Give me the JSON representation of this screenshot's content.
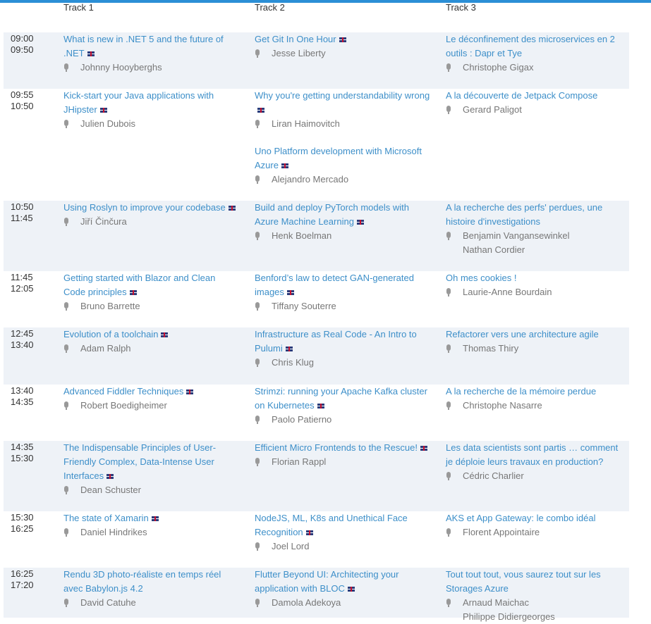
{
  "tracks": [
    "Track 1",
    "Track 2",
    "Track 3"
  ],
  "slots": [
    {
      "start": "09:00",
      "end": "09:50",
      "cells": [
        [
          {
            "title": "What is new in .NET 5 and the future of .NET",
            "english": true,
            "speakers": [
              "Johnny Hooyberghs"
            ]
          }
        ],
        [
          {
            "title": "Get Git In One Hour",
            "english": true,
            "speakers": [
              "Jesse Liberty"
            ]
          }
        ],
        [
          {
            "title": "Le déconfinement des microservices en 2 outils : Dapr et Tye",
            "english": false,
            "speakers": [
              "Christophe Gigax"
            ]
          }
        ]
      ]
    },
    {
      "start": "09:55",
      "end": "10:50",
      "cells": [
        [
          {
            "title": "Kick-start your Java applications with JHipster",
            "english": true,
            "speakers": [
              "Julien Dubois"
            ]
          }
        ],
        [
          {
            "title": "Why you're getting understandability wrong",
            "english": true,
            "speakers": [
              "Liran Haimovitch"
            ]
          },
          {
            "title": "Uno Platform development with Microsoft Azure",
            "english": true,
            "speakers": [
              "Alejandro Mercado"
            ]
          }
        ],
        [
          {
            "title": "A la découverte de Jetpack Compose",
            "english": false,
            "speakers": [
              "Gerard Paligot"
            ]
          }
        ]
      ]
    },
    {
      "start": "10:50",
      "end": "11:45",
      "cells": [
        [
          {
            "title": "Using Roslyn to improve your codebase",
            "english": true,
            "speakers": [
              "Jiří Činčura"
            ]
          }
        ],
        [
          {
            "title": "Build and deploy PyTorch models with Azure Machine Learning",
            "english": true,
            "speakers": [
              "Henk Boelman"
            ]
          }
        ],
        [
          {
            "title": "A la recherche des perfs' perdues, une histoire d'investigations",
            "english": false,
            "speakers": [
              "Benjamin Vangansewinkel",
              "Nathan Cordier"
            ]
          }
        ]
      ]
    },
    {
      "start": "11:45",
      "end": "12:05",
      "cells": [
        [
          {
            "title": "Getting started with Blazor and Clean Code principles",
            "english": true,
            "speakers": [
              "Bruno Barrette"
            ]
          }
        ],
        [
          {
            "title": "Benford’s law to detect GAN-generated images",
            "english": true,
            "speakers": [
              "Tiffany Souterre"
            ]
          }
        ],
        [
          {
            "title": "Oh mes cookies !",
            "english": false,
            "speakers": [
              "Laurie-Anne Bourdain"
            ]
          }
        ]
      ]
    },
    {
      "start": "12:45",
      "end": "13:40",
      "cells": [
        [
          {
            "title": "Evolution of a toolchain",
            "english": true,
            "speakers": [
              "Adam Ralph"
            ]
          }
        ],
        [
          {
            "title": "Infrastructure as Real Code - An Intro to Pulumi",
            "english": true,
            "speakers": [
              "Chris Klug"
            ]
          }
        ],
        [
          {
            "title": "Refactorer vers une architecture agile",
            "english": false,
            "speakers": [
              "Thomas Thiry"
            ]
          }
        ]
      ]
    },
    {
      "start": "13:40",
      "end": "14:35",
      "cells": [
        [
          {
            "title": "Advanced Fiddler Techniques",
            "english": true,
            "speakers": [
              "Robert Boedigheimer"
            ]
          }
        ],
        [
          {
            "title": "Strimzi: running your Apache Kafka cluster on Kubernetes",
            "english": true,
            "speakers": [
              "Paolo Patierno"
            ]
          }
        ],
        [
          {
            "title": "A la recherche de la mémoire perdue",
            "english": false,
            "speakers": [
              "Christophe Nasarre"
            ]
          }
        ]
      ]
    },
    {
      "start": "14:35",
      "end": "15:30",
      "cells": [
        [
          {
            "title": "The Indispensable Principles of User-Friendly Complex, Data-Intense User Interfaces",
            "english": true,
            "speakers": [
              "Dean Schuster"
            ]
          }
        ],
        [
          {
            "title": "Efficient Micro Frontends to the Rescue!",
            "english": true,
            "speakers": [
              "Florian Rappl"
            ]
          }
        ],
        [
          {
            "title": "Les data scientists sont partis … comment je déploie leurs travaux en production?",
            "english": false,
            "speakers": [
              "Cédric Charlier"
            ]
          }
        ]
      ]
    },
    {
      "start": "15:30",
      "end": "16:25",
      "cells": [
        [
          {
            "title": "The state of Xamarin",
            "english": true,
            "speakers": [
              "Daniel Hindrikes"
            ]
          }
        ],
        [
          {
            "title": "NodeJS, ML, K8s and Unethical Face Recognition",
            "english": true,
            "speakers": [
              "Joel Lord"
            ]
          }
        ],
        [
          {
            "title": "AKS et App Gateway: le combo idéal",
            "english": false,
            "speakers": [
              "Florent Appointaire"
            ]
          }
        ]
      ]
    },
    {
      "start": "16:25",
      "end": "17:20",
      "cells": [
        [
          {
            "title": "Rendu 3D photo-réaliste en temps réel avec Babylon.js 4.2",
            "english": false,
            "speakers": [
              "David Catuhe"
            ]
          }
        ],
        [
          {
            "title": "Flutter Beyond UI: Architecting your application with BLOC",
            "english": true,
            "speakers": [
              "Damola Adekoya"
            ]
          }
        ],
        [
          {
            "title": "Tout tout tout, vous saurez tout sur les Storages Azure",
            "english": false,
            "speakers": [
              "Arnaud Maichac",
              "Philippe Didiergeorges"
            ]
          }
        ]
      ]
    }
  ]
}
